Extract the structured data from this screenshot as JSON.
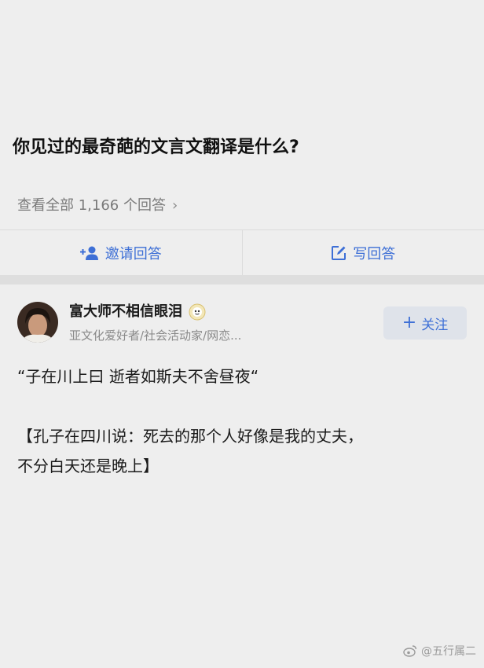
{
  "question": {
    "title": "你见过的最奇葩的文言文翻译是什么?",
    "view_all": "查看全部 1,166 个回答"
  },
  "actions": {
    "invite_label": "邀请回答",
    "write_label": "写回答"
  },
  "answer": {
    "author_name": "富大师不相信眼泪",
    "author_desc": "亚文化爱好者/社会活动家/网恋...",
    "follow_label": "关注",
    "quote": "“子在川上曰 逝者如斯夫不舍昼夜“",
    "translation_line1": "【孔子在四川说：死去的那个人好像是我的丈夫，",
    "translation_line2": "不分白天还是晚上】"
  },
  "watermark": "@五行属二",
  "colors": {
    "accent": "#3d6fd6",
    "background": "#eeeeee",
    "muted_text": "#7a7a7a"
  }
}
